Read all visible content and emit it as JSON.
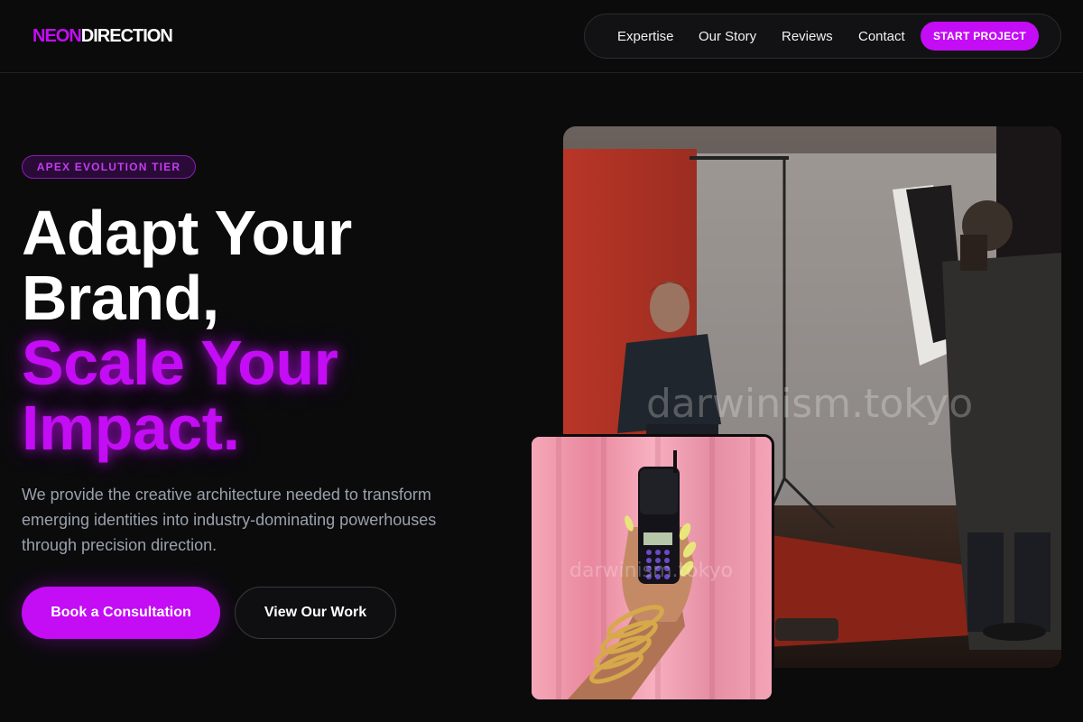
{
  "brand": {
    "neon": "NEON",
    "direction": "DIRECTION",
    "accent_color": "#c40cf5"
  },
  "nav": {
    "links": [
      "Expertise",
      "Our Story",
      "Reviews",
      "Contact"
    ],
    "cta_label": "START PROJECT"
  },
  "hero": {
    "badge": "APEX EVOLUTION TIER",
    "headline_white": [
      "Adapt Your",
      "Brand,"
    ],
    "headline_purple": [
      "Scale Your",
      "Impact."
    ],
    "description": "We provide the creative architecture needed to transform emerging identities into industry-dominating powerhouses through precision direction.",
    "primary_cta": "Book a Consultation",
    "secondary_cta": "View Our Work"
  },
  "images": {
    "main_watermark": "darwinism.tokyo",
    "small_watermark": "darwinism.tokyo"
  }
}
